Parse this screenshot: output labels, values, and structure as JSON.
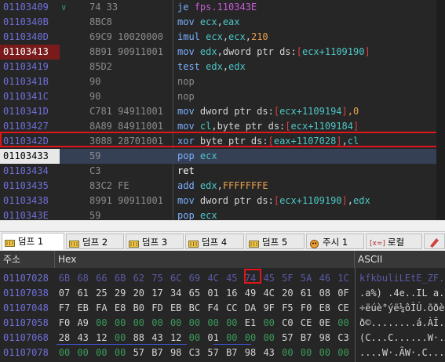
{
  "disasm": {
    "rows": [
      {
        "addr": "01103409",
        "mark": "∨",
        "bytes": "74 33",
        "instr": [
          {
            "t": "je ",
            "c": "kw"
          },
          {
            "t": "fps.110343E",
            "c": "seg"
          }
        ]
      },
      {
        "addr": "0110340B",
        "mark": "",
        "bytes": "8BC8",
        "instr": [
          {
            "t": "mov ",
            "c": "kw"
          },
          {
            "t": "ecx",
            "c": "reg"
          },
          {
            "t": ",",
            "c": "wh"
          },
          {
            "t": "eax",
            "c": "reg"
          }
        ]
      },
      {
        "addr": "0110340D",
        "mark": "",
        "bytes": "69C9 10020000",
        "instr": [
          {
            "t": "imul ",
            "c": "kw"
          },
          {
            "t": "ecx",
            "c": "reg"
          },
          {
            "t": ",",
            "c": "wh"
          },
          {
            "t": "ecx",
            "c": "reg"
          },
          {
            "t": ",",
            "c": "wh"
          },
          {
            "t": "210",
            "c": "num"
          }
        ]
      },
      {
        "addr": "01103413",
        "mark": "",
        "bytes": "8B91 90911001",
        "instr": [
          {
            "t": "mov ",
            "c": "kw"
          },
          {
            "t": "edx",
            "c": "reg"
          },
          {
            "t": ",dword ptr ds:",
            "c": "wh"
          },
          {
            "t": "[",
            "c": "red"
          },
          {
            "t": "ecx+1109190",
            "c": "reg"
          },
          {
            "t": "]",
            "c": "red"
          }
        ]
      },
      {
        "addr": "01103419",
        "mark": "",
        "bytes": "85D2",
        "instr": [
          {
            "t": "test ",
            "c": "kw"
          },
          {
            "t": "edx",
            "c": "reg"
          },
          {
            "t": ",",
            "c": "wh"
          },
          {
            "t": "edx",
            "c": "reg"
          }
        ]
      },
      {
        "addr": "0110341B",
        "mark": "",
        "bytes": "90",
        "instr": [
          {
            "t": "nop",
            "c": "gray"
          }
        ]
      },
      {
        "addr": "0110341C",
        "mark": "",
        "bytes": "90",
        "instr": [
          {
            "t": "nop",
            "c": "gray"
          }
        ]
      },
      {
        "addr": "0110341D",
        "mark": "",
        "bytes": "C781 94911001",
        "instr": [
          {
            "t": "mov ",
            "c": "kw"
          },
          {
            "t": "dword ptr ds:",
            "c": "wh"
          },
          {
            "t": "[",
            "c": "red"
          },
          {
            "t": "ecx+1109194",
            "c": "reg"
          },
          {
            "t": "]",
            "c": "red"
          },
          {
            "t": ",0",
            "c": "num"
          }
        ]
      },
      {
        "addr": "01103427",
        "mark": "",
        "bytes": "8A89 84911001",
        "instr": [
          {
            "t": "mov ",
            "c": "kw"
          },
          {
            "t": "cl",
            "c": "reg"
          },
          {
            "t": ",byte ptr ds:",
            "c": "wh"
          },
          {
            "t": "[",
            "c": "red"
          },
          {
            "t": "ecx+1109184",
            "c": "reg"
          },
          {
            "t": "]",
            "c": "red"
          }
        ]
      },
      {
        "addr": "0110342D",
        "mark": "",
        "bytes": "3088 28701001",
        "instr": [
          {
            "t": "xor ",
            "c": "kw"
          },
          {
            "t": "byte ptr ds:",
            "c": "wh"
          },
          {
            "t": "[",
            "c": "red"
          },
          {
            "t": "eax+1107028",
            "c": "reg"
          },
          {
            "t": "]",
            "c": "red"
          },
          {
            "t": ",",
            "c": "wh"
          },
          {
            "t": "cl",
            "c": "reg"
          }
        ]
      },
      {
        "addr": "01103433",
        "mark": "",
        "bytes": "59",
        "instr": [
          {
            "t": "pop ",
            "c": "kw"
          },
          {
            "t": "ecx",
            "c": "reg"
          }
        ]
      },
      {
        "addr": "01103434",
        "mark": "",
        "bytes": "C3",
        "instr": [
          {
            "t": "ret",
            "c": "ret"
          }
        ]
      },
      {
        "addr": "01103435",
        "mark": "",
        "bytes": "83C2 FE",
        "instr": [
          {
            "t": "add ",
            "c": "kw"
          },
          {
            "t": "edx",
            "c": "reg"
          },
          {
            "t": ",",
            "c": "wh"
          },
          {
            "t": "FFFFFFFE",
            "c": "num"
          }
        ]
      },
      {
        "addr": "01103438",
        "mark": "",
        "bytes": "8991 90911001",
        "instr": [
          {
            "t": "mov ",
            "c": "kw"
          },
          {
            "t": "dword ptr ds:",
            "c": "wh"
          },
          {
            "t": "[",
            "c": "red"
          },
          {
            "t": "ecx+1109190",
            "c": "reg"
          },
          {
            "t": "]",
            "c": "red"
          },
          {
            "t": ",",
            "c": "wh"
          },
          {
            "t": "edx",
            "c": "reg"
          }
        ]
      },
      {
        "addr": "0110343E",
        "mark": "",
        "bytes": "59",
        "instr": [
          {
            "t": "pop ",
            "c": "kw"
          },
          {
            "t": "ecx",
            "c": "reg"
          }
        ]
      }
    ],
    "selected_addr": "01103433",
    "breakpoint_addr": "01103413",
    "highlighted_addr": "0110342D"
  },
  "tabs": [
    {
      "label": "덤프 1",
      "icon": "memory-icon",
      "active": true
    },
    {
      "label": "덤프 2",
      "icon": "memory-icon",
      "active": false
    },
    {
      "label": "덤프 3",
      "icon": "memory-icon",
      "active": false
    },
    {
      "label": "덤프 4",
      "icon": "memory-icon",
      "active": false
    },
    {
      "label": "덤프 5",
      "icon": "memory-icon",
      "active": false
    },
    {
      "label": "주시 1",
      "icon": "watch-icon",
      "active": false
    },
    {
      "label": "로컬",
      "icon": "locals-icon",
      "active": false
    }
  ],
  "locals_tab_prefix": "[x=]",
  "hex_header": {
    "addr": "주소",
    "hex": "Hex",
    "ascii": "ASCII"
  },
  "hex_rows": [
    {
      "addr": "01107028",
      "bytes": [
        "6B",
        "68",
        "66",
        "6B",
        "62",
        "75",
        "6C",
        "69",
        "4C",
        "45",
        "74",
        "45",
        "5F",
        "5A",
        "46",
        "1C"
      ],
      "ascii": "kfkbuliLEtE_ZF."
    },
    {
      "addr": "01107038",
      "bytes": [
        "07",
        "61",
        "25",
        "29",
        "20",
        "17",
        "34",
        "65",
        "01",
        "16",
        "49",
        "4C",
        "20",
        "61",
        "08",
        "0F"
      ],
      "ascii": ".a%) .4e..IL a.."
    },
    {
      "addr": "01107048",
      "bytes": [
        "F7",
        "EB",
        "FA",
        "E8",
        "B0",
        "FD",
        "EB",
        "BC",
        "F4",
        "CC",
        "DA",
        "9F",
        "F5",
        "F0",
        "E8",
        "CE"
      ],
      "ascii": "÷ëúè°ýë¼ôÌÚ.õðèÎ"
    },
    {
      "addr": "01107058",
      "bytes": [
        "F0",
        "A9",
        "00",
        "00",
        "00",
        "00",
        "00",
        "00",
        "00",
        "00",
        "E1",
        "00",
        "C0",
        "CE",
        "0E",
        "00"
      ],
      "ascii": "ð©........á.ÀÎ.."
    },
    {
      "addr": "01107068",
      "bytes": [
        "28",
        "43",
        "12",
        "00",
        "88",
        "43",
        "12",
        "00",
        "01",
        "00",
        "00",
        "00",
        "57",
        "B7",
        "98",
        "C3"
      ],
      "ascii": "(C...C......W·.Ã"
    },
    {
      "addr": "01107078",
      "bytes": [
        "00",
        "00",
        "00",
        "00",
        "57",
        "B7",
        "98",
        "C3",
        "57",
        "B7",
        "98",
        "43",
        "00",
        "00",
        "00",
        "00"
      ],
      "ascii": "....W·.ÃW·.C...."
    }
  ],
  "highlighted_byte": {
    "row": 0,
    "col": 10
  },
  "colors": {
    "highlight": "#e0161b",
    "addr": "#6f6fd8",
    "keyword": "#7ab0ff",
    "register": "#4ec6c6",
    "number": "#e8a04e"
  }
}
